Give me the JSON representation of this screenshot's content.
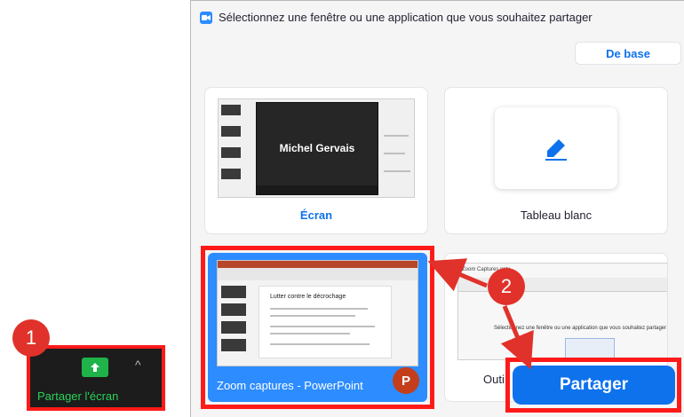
{
  "dialog": {
    "title": "Sélectionnez une fenêtre ou une application que vous souhaitez partager",
    "mode_tab_label": "De base"
  },
  "tiles": {
    "screen": {
      "label": "Écran",
      "video_participant_name": "Michel Gervais"
    },
    "whiteboard": {
      "label": "Tableau blanc"
    },
    "powerpoint": {
      "label": "Zoom captures - PowerPoint",
      "slide_title": "Lutter contre le décrochage",
      "app_icon_letter": "P"
    },
    "other": {
      "label": "Outi",
      "thumb_menu": "Zoom Captures.pptx",
      "thumb_text": "Sélectionnez une fenêtre ou une application que vous souhaitez partager"
    }
  },
  "share_button_label": "Partager",
  "zoom_toolbar": {
    "share_screen_label": "Partager l'écran"
  },
  "annotations": {
    "step1": "1",
    "step2": "2"
  },
  "colors": {
    "accent": "#0e72ed",
    "highlight": "#ff1a1a",
    "share_green": "#1fb34a"
  }
}
